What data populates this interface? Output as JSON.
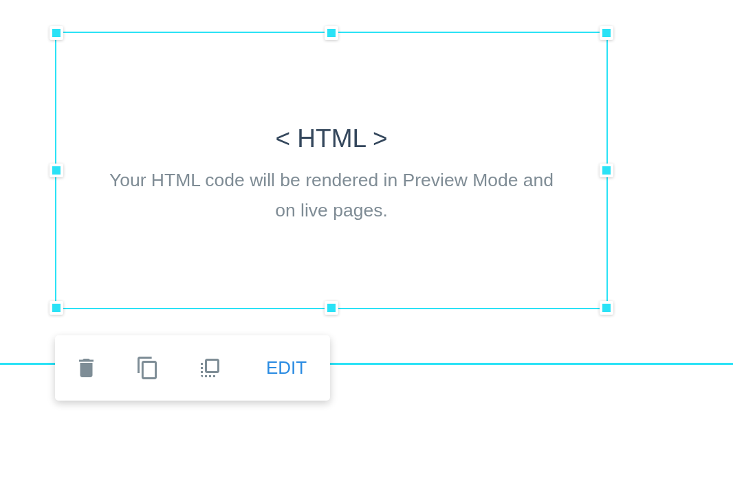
{
  "html_block": {
    "title": "< HTML >",
    "description": "Your HTML code will be rendered in Preview Mode and on live pages.",
    "selected": true
  },
  "toolbar": {
    "edit_label": "EDIT"
  }
}
